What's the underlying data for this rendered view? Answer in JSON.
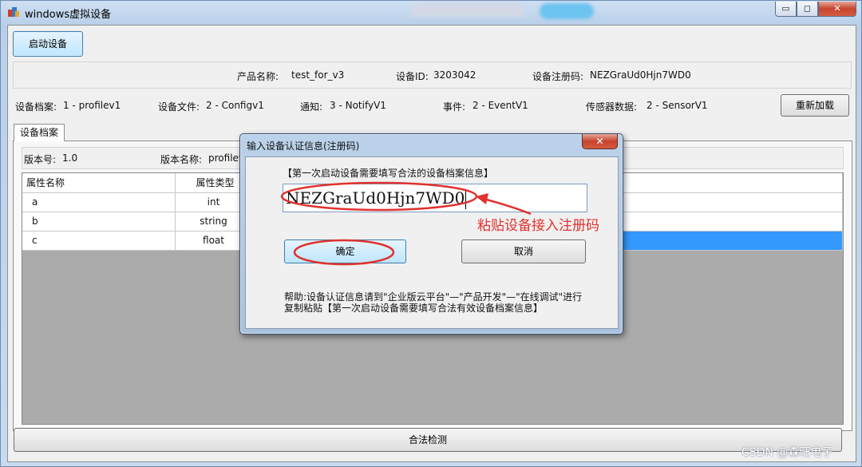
{
  "window": {
    "title": "windows虚拟设备",
    "controls": {
      "minimize": "▭",
      "maximize": "◻",
      "close": "✕"
    }
  },
  "toolbar": {
    "start_label": "启动设备"
  },
  "product_info": {
    "product_name_label": "产品名称:",
    "product_name": "test_for_v3",
    "device_id_label": "设备ID:",
    "device_id": "3203042",
    "reg_code_label": "设备注册码:",
    "reg_code": "NEZGraUd0Hjn7WD0"
  },
  "files": {
    "profile_label": "设备档案:",
    "profile": "1 - profilev1",
    "config_label": "设备文件:",
    "config": "2 - Configv1",
    "notify_label": "通知:",
    "notify": "3 - NotifyV1",
    "event_label": "事件:",
    "event": "2 - EventV1",
    "sensor_label": "传感器数据:",
    "sensor": "2 - SensorV1",
    "reload_label": "重新加载"
  },
  "tabs": [
    {
      "label": "设备档案"
    }
  ],
  "version": {
    "version_no_label": "版本号:",
    "version_no": "1.0",
    "version_name_label": "版本名称:",
    "version_name": "profilev1"
  },
  "grid": {
    "headers": [
      "属性名称",
      "属性类型"
    ],
    "rows": [
      {
        "name": "a",
        "type": "int"
      },
      {
        "name": "b",
        "type": "string"
      },
      {
        "name": "c",
        "type": "float"
      }
    ],
    "selected_row": 2
  },
  "bottom": {
    "check_label": "合法检测"
  },
  "dialog": {
    "title": "输入设备认证信息(注册码)",
    "close": "✕",
    "heading": "【第一次启动设备需要填写合法的设备档案信息】",
    "code_value": "NEZGraUd0Hjn7WD0",
    "ok_label": "确定",
    "cancel_label": "取消",
    "help_line1": "帮助:设备认证信息请到\"企业版云平台\"—\"产品开发\"—\"在线调试\"进行",
    "help_line2": "复制粘贴【第一次启动设备需要填写合法有效设备档案信息】"
  },
  "annotation": {
    "text": "粘贴设备接入注册码",
    "color": "#e0322e"
  },
  "watermark": "CSDN @森旺电子"
}
